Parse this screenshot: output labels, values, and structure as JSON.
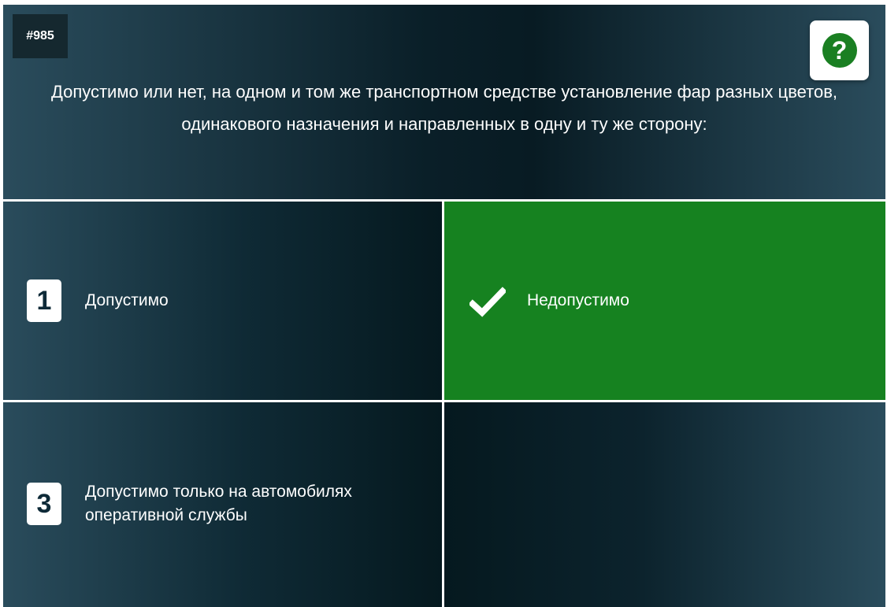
{
  "question": {
    "number": "#985",
    "text": "Допустимо или нет, на одном и том же транспортном средстве установление фар разных цветов, одинакового назначения и направленных в одну и ту же сторону:",
    "help_icon": "question-mark-icon",
    "help_symbol": "?"
  },
  "answers": [
    {
      "badge": "1",
      "label": "Допустимо",
      "selected": false
    },
    {
      "badge": "",
      "label": "Недопустимо",
      "selected": true,
      "icon": "checkmark-icon"
    },
    {
      "badge": "3",
      "label": "Допустимо только на автомобилях оперативной службы",
      "selected": false
    },
    {
      "badge": "",
      "label": "",
      "selected": false
    }
  ],
  "colors": {
    "correct": "#168220",
    "help_icon": "#1a7f22",
    "panel_dark": "#081b23",
    "panel_light": "#2a4c5c"
  }
}
